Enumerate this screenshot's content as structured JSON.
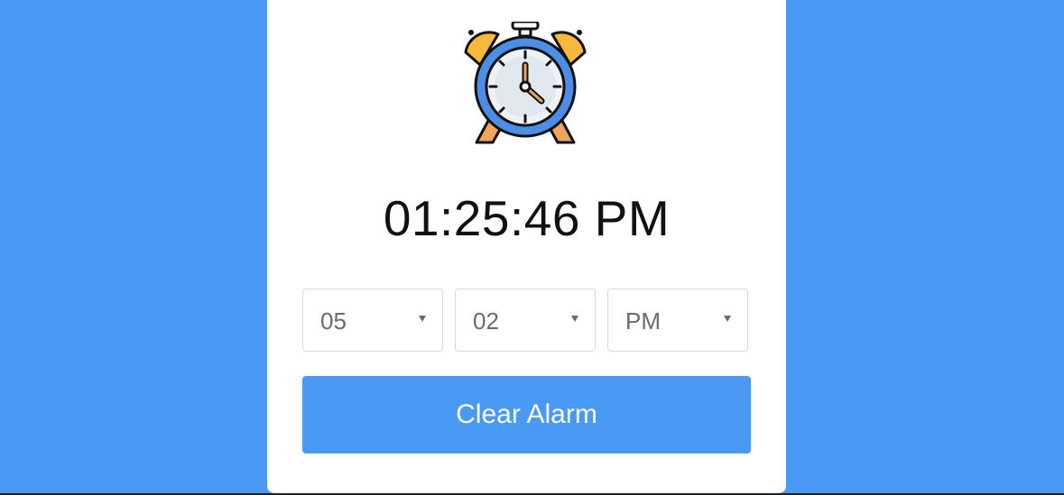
{
  "clock": {
    "icon": "alarm-clock-icon",
    "current_time": "01:25:46 PM"
  },
  "alarm": {
    "hour": "05",
    "minute": "02",
    "period": "PM",
    "clear_label": "Clear Alarm"
  },
  "colors": {
    "background": "#4a99f4",
    "card": "#ffffff",
    "button": "#4a99f4",
    "clock_ring": "#4a8ee8",
    "clock_bells": "#f6b93b",
    "clock_legs": "#f0a55a"
  }
}
